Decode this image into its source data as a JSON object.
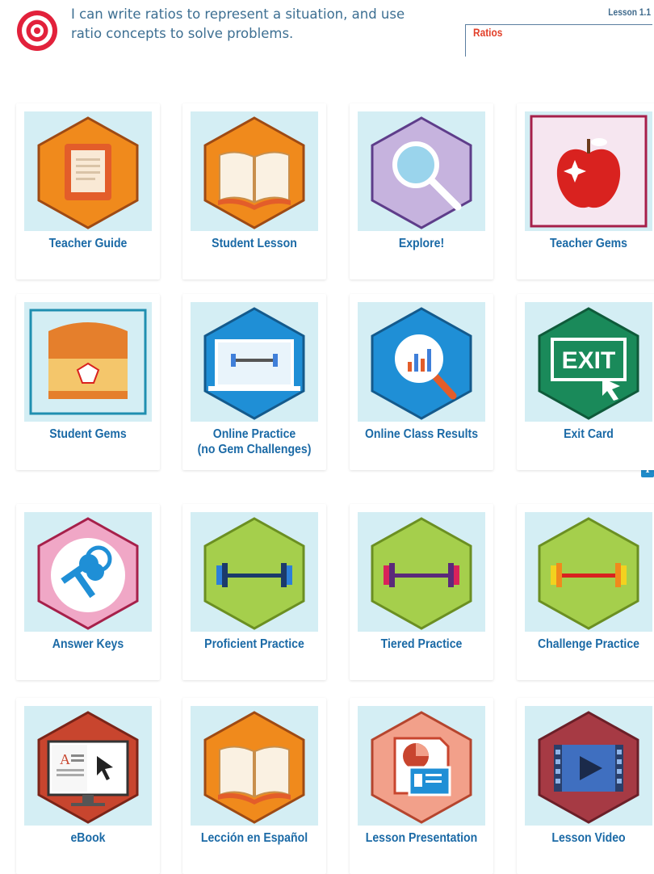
{
  "header": {
    "goal_text": "I can write ratios to represent a situation, and use ratio concepts to solve problems.",
    "lesson_number": "Lesson 1.1",
    "lesson_title": "Ratios"
  },
  "colors": {
    "label": "#1b6aa6",
    "tile_bg": "#d4eef4",
    "target_red": "#e2213b"
  },
  "tiles": [
    {
      "label": "Teacher Guide",
      "icon": "tablet-icon"
    },
    {
      "label": "Student Lesson",
      "icon": "open-book-icon"
    },
    {
      "label": "Explore!",
      "icon": "magnifier-icon"
    },
    {
      "label": "Teacher Gems",
      "icon": "apple-icon"
    },
    {
      "label": "Student Gems",
      "icon": "treasure-chest-icon"
    },
    {
      "label": "Online Practice\n(no Gem Challenges)",
      "icon": "laptop-dumbbell-icon"
    },
    {
      "label": "Online Class Results",
      "icon": "chart-magnifier-icon"
    },
    {
      "label": "Exit Card",
      "icon": "exit-sign-icon"
    },
    {
      "label": "Answer Keys",
      "icon": "keys-icon"
    },
    {
      "label": "Proficient Practice",
      "icon": "dumbbell-icon"
    },
    {
      "label": "Tiered Practice",
      "icon": "dumbbell-icon"
    },
    {
      "label": "Challenge Practice",
      "icon": "dumbbell-icon"
    },
    {
      "label": "eBook",
      "icon": "monitor-icon"
    },
    {
      "label": "Lección en Español",
      "icon": "open-book-icon"
    },
    {
      "label": "Lesson Presentation",
      "icon": "presentation-icon"
    },
    {
      "label": "Lesson Video",
      "icon": "film-play-icon"
    }
  ]
}
